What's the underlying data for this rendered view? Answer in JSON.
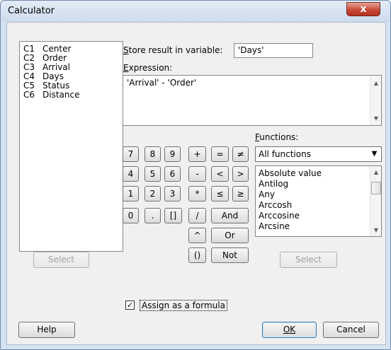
{
  "window": {
    "title": "Calculator",
    "close_glyph": "x"
  },
  "variables": [
    {
      "col": "C1",
      "name": "Center"
    },
    {
      "col": "C2",
      "name": "Order"
    },
    {
      "col": "C3",
      "name": "Arrival"
    },
    {
      "col": "C4",
      "name": "Days"
    },
    {
      "col": "C5",
      "name": "Status"
    },
    {
      "col": "C6",
      "name": "Distance"
    }
  ],
  "store": {
    "label_ul": "S",
    "label_rest": "tore result in variable:",
    "value": "'Days'"
  },
  "expression": {
    "label_ul": "E",
    "label_rest": "xpression:",
    "value": "'Arrival' - 'Order'"
  },
  "keypad": {
    "row1": [
      "7",
      "8",
      "9",
      "+",
      "=",
      "≠"
    ],
    "row2": [
      "4",
      "5",
      "6",
      "-",
      "<",
      ">"
    ],
    "row3": [
      "1",
      "2",
      "3",
      "*",
      "≤",
      "≥"
    ],
    "row4": [
      "0",
      ".",
      "[]",
      "/",
      "And"
    ],
    "row5": [
      "^",
      "Or"
    ],
    "row6": [
      "()",
      "Not"
    ]
  },
  "functions": {
    "label_ul": "F",
    "label_rest": "unctions:",
    "selected": "All functions",
    "items": [
      "Absolute value",
      "Antilog",
      "Any",
      "Arccosh",
      "Arccosine",
      "Arcsine"
    ]
  },
  "buttons": {
    "select_left": "Select",
    "select_right": "Select",
    "help": "Help",
    "ok": "OK",
    "cancel": "Cancel"
  },
  "assign_formula": {
    "label": "Assign as a formula",
    "checked": true,
    "check_glyph": "✓"
  }
}
